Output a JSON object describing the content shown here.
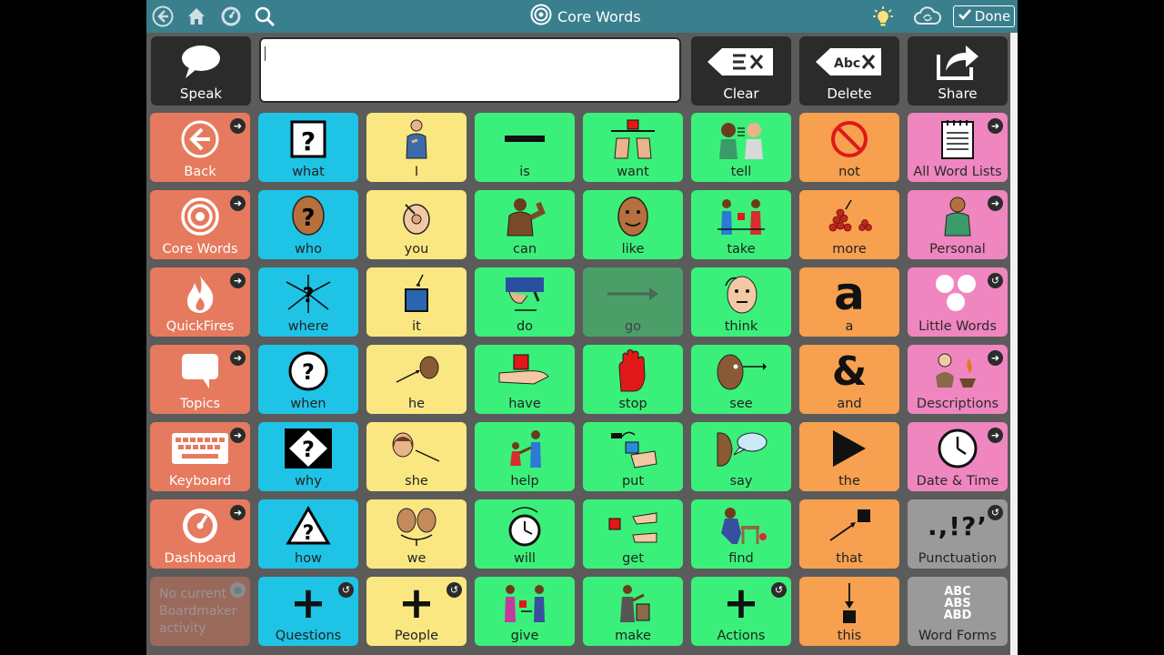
{
  "topbar": {
    "title": "Core Words",
    "done_label": "Done",
    "icons": [
      "back-circle-icon",
      "home-icon",
      "dashboard-gauge-icon",
      "search-icon",
      "target-icon",
      "lightbulb-icon",
      "sync-cloud-icon",
      "checkmark-icon"
    ]
  },
  "toolbar": {
    "speak_label": "Speak",
    "message_text": "",
    "clear_label": "Clear",
    "delete_label": "Delete",
    "share_label": "Share",
    "clear_icon_text": "EX",
    "delete_icon_text": "Abc X"
  },
  "colors": {
    "nav": "#e67a5e",
    "question": "#1fc3e6",
    "pronoun": "#fbe782",
    "verb": "#3bf07a",
    "function": "#f7a050",
    "folder": "#ef86bf",
    "gray": "#9a9a9a",
    "topbar": "#3a7f8e",
    "frame": "#5b5b5b"
  },
  "nav": [
    {
      "label": "Back",
      "icon": "back-arrow-icon"
    },
    {
      "label": "Core Words",
      "icon": "target-icon"
    },
    {
      "label": "QuickFires",
      "icon": "fire-icon"
    },
    {
      "label": "Topics",
      "icon": "speech-bubble-icon"
    },
    {
      "label": "Keyboard",
      "icon": "keyboard-icon"
    },
    {
      "label": "Dashboard",
      "icon": "dashboard-gauge-icon"
    },
    {
      "label": "No current Boardmaker activity",
      "icon": "boardmaker-icon"
    }
  ],
  "words": {
    "what": "what",
    "who": "who",
    "where": "where",
    "when": "when",
    "why": "why",
    "how": "how",
    "questions": "Questions",
    "i": "I",
    "you": "you",
    "it": "it",
    "he": "he",
    "she": "she",
    "we": "we",
    "people": "People",
    "is": "is",
    "can": "can",
    "do": "do",
    "have": "have",
    "help": "help",
    "will": "will",
    "give": "give",
    "want": "want",
    "like": "like",
    "go": "go",
    "stop": "stop",
    "put": "put",
    "get": "get",
    "make": "make",
    "tell": "tell",
    "take": "take",
    "think": "think",
    "see": "see",
    "say": "say",
    "find": "find",
    "actions": "Actions",
    "not": "not",
    "more": "more",
    "a": "a",
    "and": "and",
    "the": "the",
    "that": "that",
    "this": "this",
    "all_word_lists": "All Word Lists",
    "personal": "Personal",
    "little_words": "Little Words",
    "descriptions": "Descriptions",
    "date_time": "Date & Time",
    "punctuation": "Punctuation",
    "word_forms": "Word Forms"
  },
  "glyphs": {
    "a": "a",
    "and": "&",
    "punct": ".,!?’",
    "abc_lines": [
      "ABC",
      "ABS",
      "ABD"
    ],
    "plus": "+"
  }
}
